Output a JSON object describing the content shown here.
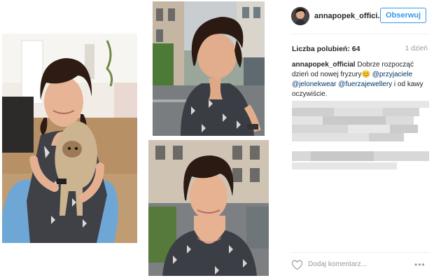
{
  "post": {
    "username": "annapopek_offici...",
    "follow_label": "Obserwuj",
    "likes_text": "Liczba polubień: 64",
    "age_text": "1 dzień",
    "caption_user": "annapopek_official",
    "caption_t1": " Dobrze rozpocząć dzień od nowej fryzury😊 ",
    "caption_m1": "@przyjaciele",
    "caption_m2": "@jelonekwear",
    "caption_m3": "@fuerzajewellery",
    "caption_t2": " i od kawy oczywiście.",
    "comment_placeholder": "Dodaj komentarz...",
    "more_label": "•••"
  },
  "icons": {
    "heart": "heart-icon",
    "more": "more-options-icon"
  },
  "colors": {
    "accent": "#3897f0",
    "text": "#262626",
    "muted": "#999999",
    "link": "#003569"
  }
}
